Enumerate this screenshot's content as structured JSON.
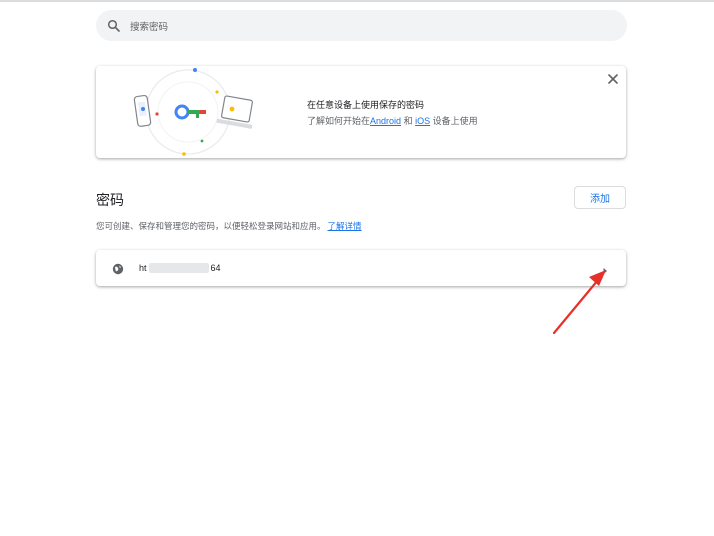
{
  "search": {
    "placeholder": "搜索密码"
  },
  "promo": {
    "line1": "在任意设备上使用保存的密码",
    "line2_prefix": "了解如何开始在",
    "android_link": "Android",
    "and_text": "和",
    "ios_link": "iOS",
    "line2_suffix": "设备上使用"
  },
  "section": {
    "title": "密码",
    "add_label": "添加",
    "description": "您可创建、保存和管理您的密码，以便轻松登录网站和应用。",
    "learn_more": "了解详情"
  },
  "passwords": [
    {
      "site_prefix": "ht",
      "site_suffix": "64"
    }
  ],
  "colors": {
    "accent": "#1a73e8",
    "annotation_arrow": "#e8302a"
  }
}
